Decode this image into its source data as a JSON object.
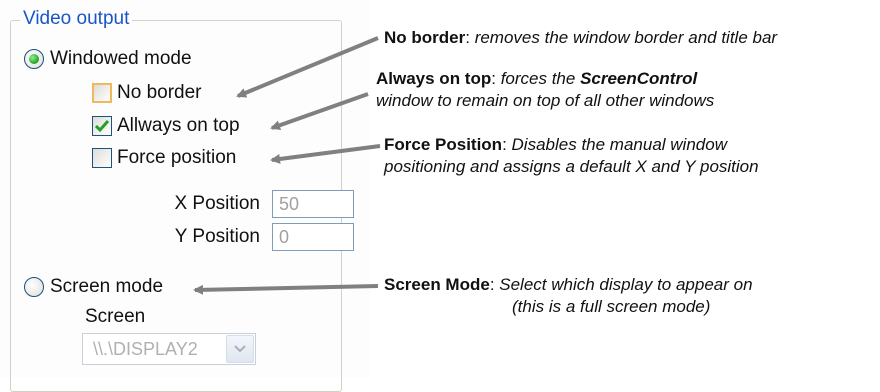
{
  "groupbox": {
    "title": "Video output"
  },
  "windowed": {
    "label": "Windowed mode",
    "options": [
      {
        "label": "No border",
        "checked": false
      },
      {
        "label": "Allways on top",
        "checked": true
      },
      {
        "label": "Force position",
        "checked": false
      }
    ],
    "x_position": {
      "label": "X Position",
      "value": "50"
    },
    "y_position": {
      "label": "Y Position",
      "value": "0"
    }
  },
  "screen_mode": {
    "label": "Screen mode",
    "screen_label": "Screen",
    "screen_value": "\\\\.\\DISPLAY2"
  },
  "annotations": [
    {
      "term": "No border",
      "desc1": "removes the window border and title bar"
    },
    {
      "term": "Always on top",
      "desc1": "forces the ",
      "emph": "ScreenControl",
      "desc2": "window to remain on top of all other windows"
    },
    {
      "term": "Force Position",
      "desc1": "Disables the manual window",
      "desc2": "positioning and assigns a default X and Y position"
    },
    {
      "term": "Screen Mode",
      "desc1": "Select which display to appear on",
      "desc2": "(this is a full screen mode)"
    }
  ],
  "colors": {
    "legend": "#1a55c8",
    "arrow": "#808080",
    "check_mark": "#21a121",
    "radio_dot": "#21a121"
  }
}
